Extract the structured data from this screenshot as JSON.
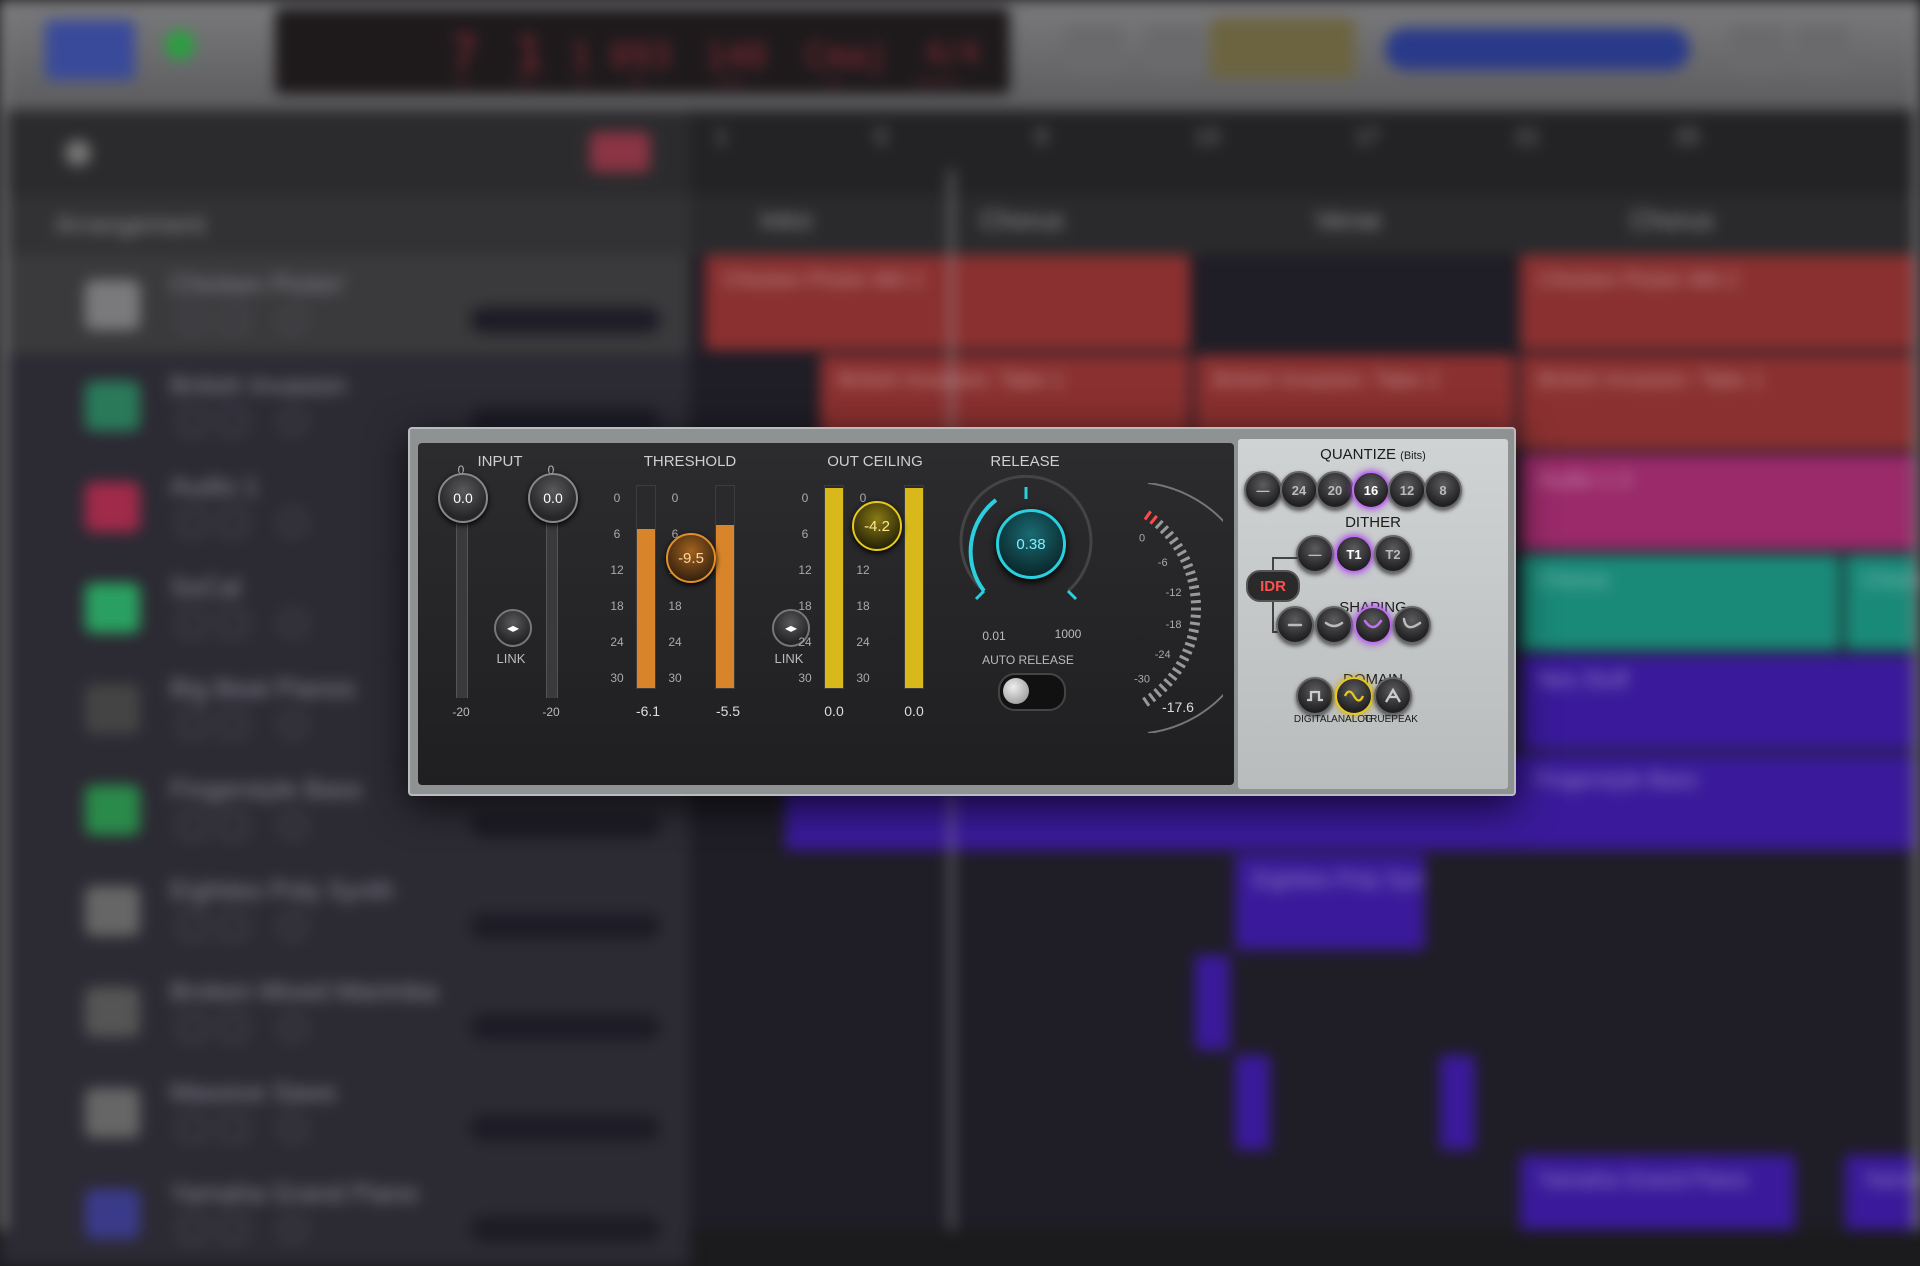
{
  "background": {
    "lcd": {
      "bar": "7",
      "beat": "1",
      "div": "1",
      "tick": "093",
      "tempo": "140",
      "key": "Cmaj",
      "sig": "4/4"
    },
    "lcd_labels": [
      "bar",
      "beat",
      "div",
      "tick",
      "tempo",
      "key",
      "signature"
    ],
    "ruler": [
      "1",
      "5",
      "9",
      "13",
      "17",
      "21",
      "25"
    ],
    "arrangement_label": "Arrangement",
    "markers": [
      "Intro",
      "Chorus",
      "Verse",
      "Chorus"
    ],
    "tracks": [
      {
        "name": "Chicken Pickin'"
      },
      {
        "name": "British Invasion"
      },
      {
        "name": "Audio 1"
      },
      {
        "name": "SoCal"
      },
      {
        "name": "Big Beat Pianos"
      },
      {
        "name": "Fingerstyle Bass"
      },
      {
        "name": "Eighties Poly Synth"
      },
      {
        "name": "Broken Mixed Marimba"
      },
      {
        "name": "Massive Saws"
      },
      {
        "name": "Yamaha Grand Piano"
      }
    ],
    "regions": [
      {
        "label": "Chicken Pickin Wit 2"
      },
      {
        "label": "Chicken Pickin Wit 2"
      },
      {
        "label": "British Invasion: Take 1"
      },
      {
        "label": "British Invasion: Take 2"
      },
      {
        "label": "British Invasion: Take 1"
      },
      {
        "label": "Audio 1.3"
      },
      {
        "label": "Chorus"
      },
      {
        "label": "Chorus"
      },
      {
        "label": "Nes Stuff"
      },
      {
        "label": "Fingerstyle Bass"
      },
      {
        "label": "Eighties Poly Syn"
      },
      {
        "label": "Yamaha Grand Piano"
      },
      {
        "label": "Yamah"
      }
    ]
  },
  "plugin": {
    "input": {
      "title": "INPUT",
      "left_value": "0.0",
      "right_value": "0.0",
      "left_top": "0",
      "right_top": "0",
      "left_bottom": "-20",
      "right_bottom": "-20",
      "link_label": "LINK"
    },
    "threshold": {
      "title": "THRESHOLD",
      "value": "-9.5",
      "meter_left": "-6.1",
      "meter_right": "-5.5",
      "scale": [
        "0",
        "6",
        "12",
        "18",
        "24",
        "30"
      ],
      "link_label": "LINK",
      "color": "#e0902a"
    },
    "out_ceiling": {
      "title": "OUT CEILING",
      "value": "-4.2",
      "meter_left": "0.0",
      "meter_right": "0.0",
      "scale": [
        "0",
        "6",
        "12",
        "18",
        "24",
        "30"
      ],
      "color": "#e8c81a"
    },
    "release": {
      "title": "RELEASE",
      "value": "0.38",
      "min": "0.01",
      "max": "1000",
      "auto_release_label": "AUTO RELEASE",
      "auto_release_on": false,
      "color": "#2ad0e0"
    },
    "gr_meter": {
      "scale": [
        "0",
        "-6",
        "-12",
        "-18",
        "-24",
        "-30"
      ],
      "value": "-17.6"
    },
    "quantize": {
      "title": "QUANTIZE",
      "subtitle": "(Bits)",
      "options": [
        "—",
        "24",
        "20",
        "16",
        "12",
        "8"
      ],
      "selected": "16"
    },
    "dither": {
      "title": "DITHER",
      "options": [
        "—",
        "T1",
        "T2"
      ],
      "selected": "T1"
    },
    "idr_label": "IDR",
    "shaping": {
      "title": "SHAPING",
      "options": [
        "none",
        "low",
        "medium",
        "high"
      ],
      "selected": "medium"
    },
    "domain": {
      "title": "DOMAIN",
      "options": [
        "DIGITAL",
        "ANALOG",
        "TRUEPEAK"
      ],
      "selected": "ANALOG"
    }
  }
}
